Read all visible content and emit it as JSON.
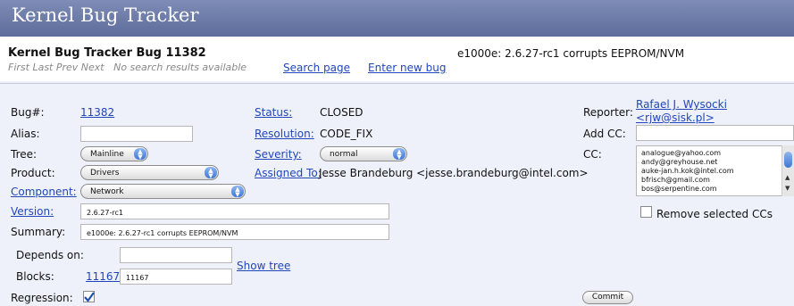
{
  "app": {
    "title": "Kernel Bug Tracker"
  },
  "header": {
    "bug_title": "Kernel Bug Tracker Bug 11382",
    "bug_summary": "e1000e: 2.6.27-rc1 corrupts EEPROM/NVM",
    "nav_text": "First Last Prev Next   No search results available",
    "search_page": "Search page",
    "enter_new_bug": "Enter new bug"
  },
  "fields": {
    "bug_label": "Bug#:",
    "bug_value": "11382",
    "alias_label": "Alias:",
    "alias_value": "",
    "tree_label": "Tree:",
    "tree_value": "Mainline",
    "product_label": "Product:",
    "product_value": "Drivers",
    "component_label": "Component:",
    "component_value": "Network",
    "version_label": "Version:",
    "version_value": "2.6.27-rc1",
    "summary_label": "Summary:",
    "summary_value": "e1000e: 2.6.27-rc1 corrupts EEPROM/NVM",
    "depends_label": "Depends on:",
    "depends_value": "",
    "blocks_label": "Blocks:",
    "blocks_link": "11167",
    "blocks_value": "11167",
    "show_tree": "Show tree",
    "regression_label": "Regression:",
    "regression_checked": true,
    "status_label": "Status:",
    "status_value": "CLOSED",
    "resolution_label": "Resolution:",
    "resolution_value": "CODE_FIX",
    "severity_label": "Severity:",
    "severity_value": "normal",
    "assigned_label": "Assigned To:",
    "assigned_value": "Jesse Brandeburg <jesse.brandeburg@intel.com>",
    "reporter_label": "Reporter:",
    "reporter_name": "Rafael J. Wysocki",
    "reporter_email": "<rjw@sisk.pl>",
    "add_cc_label": "Add CC:",
    "add_cc_value": "",
    "cc_label": "CC:",
    "cc_list": [
      "analogue@yahoo.com",
      "andy@greyhouse.net",
      "auke-jan.h.kok@intel.com",
      "bfrisch@gmail.com",
      "bos@serpentine.com"
    ],
    "remove_cc_label": "Remove selected CCs",
    "commit": "Commit"
  },
  "colors": {
    "banner": "#6b79a8",
    "link": "#2146b9",
    "page_bg": "#eef1f9"
  }
}
